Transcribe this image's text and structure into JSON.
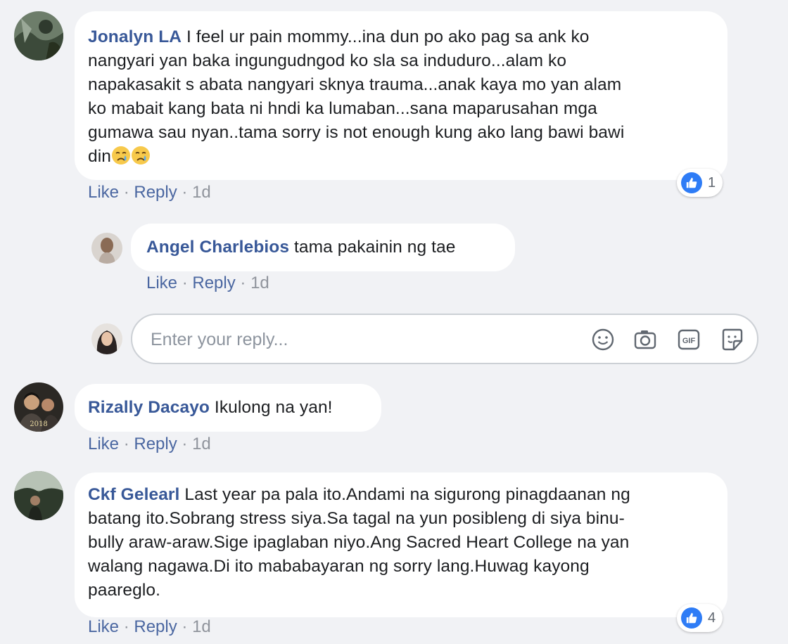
{
  "comments": [
    {
      "author": "Jonalyn LA",
      "text": "I feel ur pain mommy...ina dun po ako pag sa ank ko nangyari yan baka ingungudngod ko sla sa induduro...alam ko napakasakit s abata nangyari sknya trauma...anak kaya mo yan alam ko mabait kang bata ni hndi ka lumaban...sana maparusahan mga gumawa sau nyan..tama sorry is not enough kung ako lang bawi bawi din",
      "lines": [
        "I feel ur pain mommy...ina dun po ako pag sa ank ko",
        "nangyari yan baka ingungudngod ko sla sa induduro...alam ko",
        "napakasakit s abata nangyari sknya trauma...anak kaya mo yan alam",
        "ko mabait kang bata ni hndi ka lumaban...sana maparusahan mga",
        "gumawa sau nyan..tama sorry is not enough kung ako lang bawi bawi",
        "din"
      ],
      "emojis": [
        "crying-face",
        "crying-face"
      ],
      "like": "Like",
      "reply": "Reply",
      "time": "1d",
      "reactions": "1"
    },
    {
      "author": "Angel Charlebios",
      "text": "tama pakainin ng tae",
      "like": "Like",
      "reply": "Reply",
      "time": "1d"
    },
    {
      "author": "Rizally Dacayo",
      "text": "Ikulong na yan!",
      "like": "Like",
      "reply": "Reply",
      "time": "1d"
    },
    {
      "author": "Ckf Gelearl",
      "lines": [
        "Last year pa pala ito.Andami na sigurong pinagdaanan ng",
        "batang ito.Sobrang stress siya.Sa tagal na yun posibleng di siya binu-",
        "bully araw-araw.Sige ipaglaban niyo.Ang Sacred Heart College na yan",
        "walang nagawa.Di ito mababayaran ng sorry lang.Huwag kayong",
        "paareglo."
      ],
      "like": "Like",
      "reply": "Reply",
      "time": "1d",
      "reactions": "4"
    }
  ],
  "reply_box": {
    "placeholder": "Enter your reply...",
    "icons": [
      "emoji-icon",
      "camera-icon",
      "gif-icon",
      "sticker-icon"
    ]
  },
  "colors": {
    "author": "#385898",
    "action": "#4b67a1",
    "background": "#f1f2f5",
    "like_blue": "#2e7cf6"
  }
}
